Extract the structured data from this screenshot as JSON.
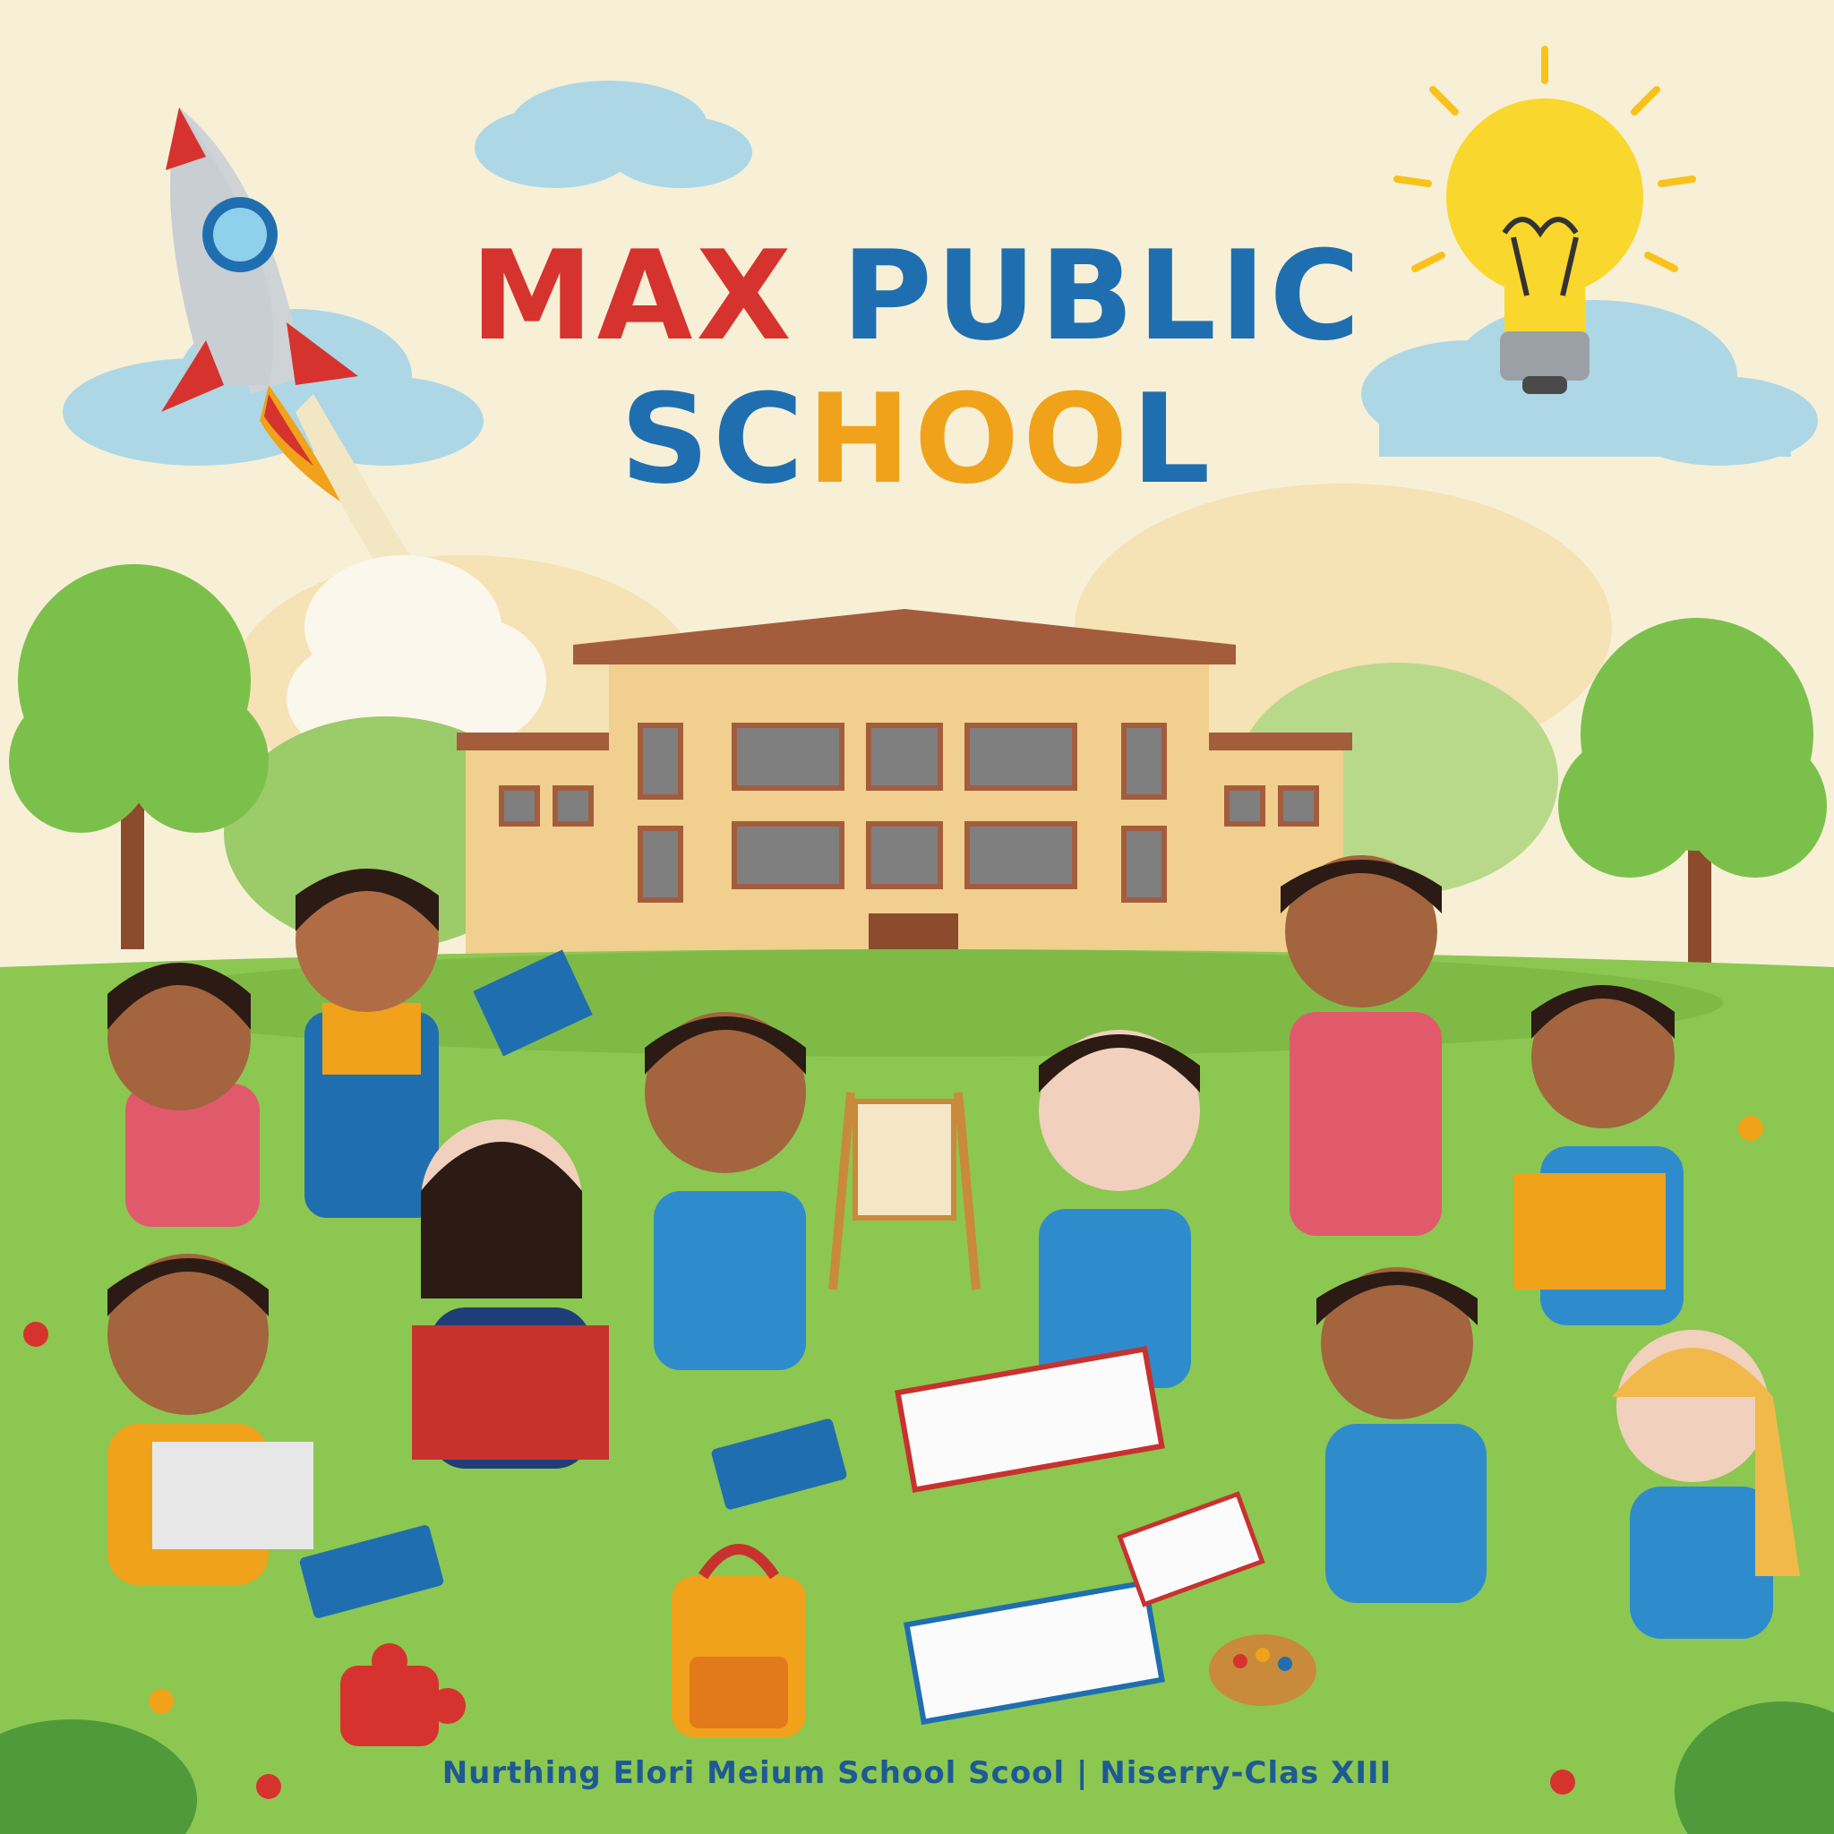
{
  "title": {
    "line1_part1": "MAX",
    "line1_part2": "PUBLIC",
    "line2_part1": "SC",
    "line2_part2": "HOO",
    "line2_part3": "L"
  },
  "footer": {
    "text": "Nurthing Elori Meium School Scool | Niserry-Clas XIII"
  },
  "colors": {
    "background": "#f7f0d6",
    "title_red": "#d6332f",
    "title_blue": "#1f6fb0",
    "title_yellow": "#f0a21a",
    "grass": "#8cc751",
    "building": "#f1cf8f"
  },
  "icons": [
    "rocket-icon",
    "lightbulb-icon",
    "cloud-icon",
    "tree-icon",
    "book-icon",
    "backpack-icon",
    "easel-icon",
    "paint-palette-icon",
    "puzzle-piece-icon",
    "flower-icon"
  ]
}
